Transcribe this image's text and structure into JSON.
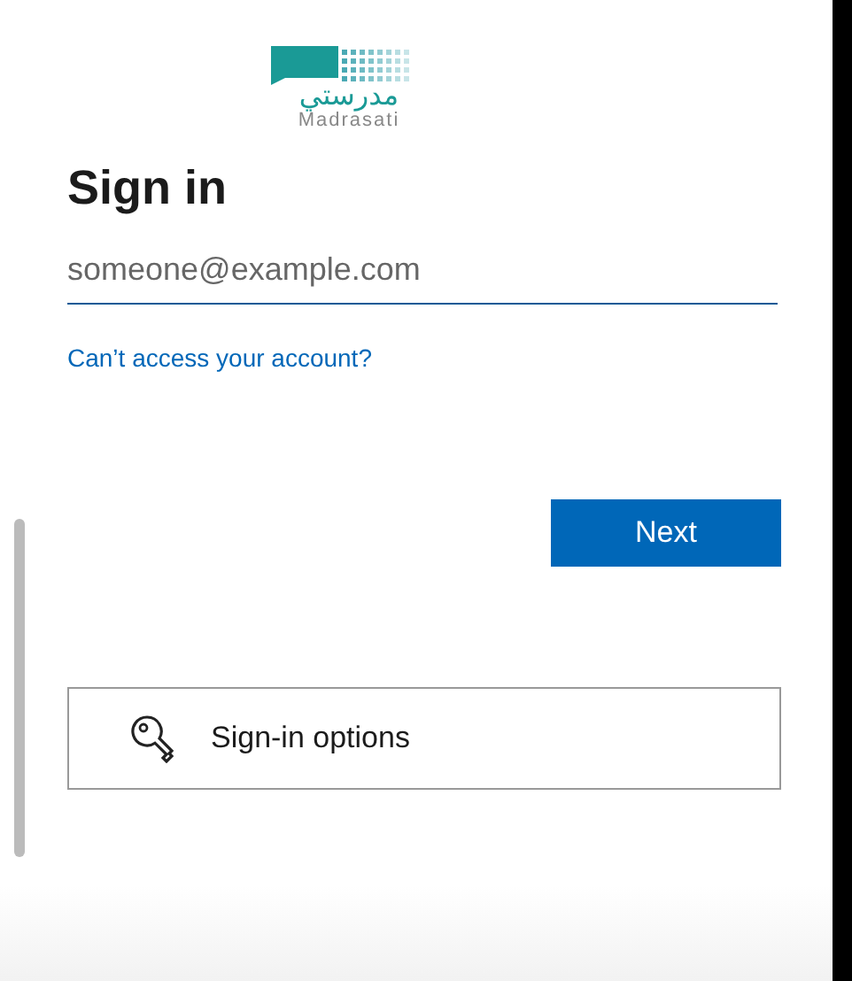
{
  "logo": {
    "arabic": "مدرستي",
    "latin": "Madrasati"
  },
  "title": "Sign in",
  "email_field": {
    "placeholder": "someone@example.com"
  },
  "link": "Can’t access your account?",
  "next_button": "Next",
  "signin_options": "Sign-in options"
}
